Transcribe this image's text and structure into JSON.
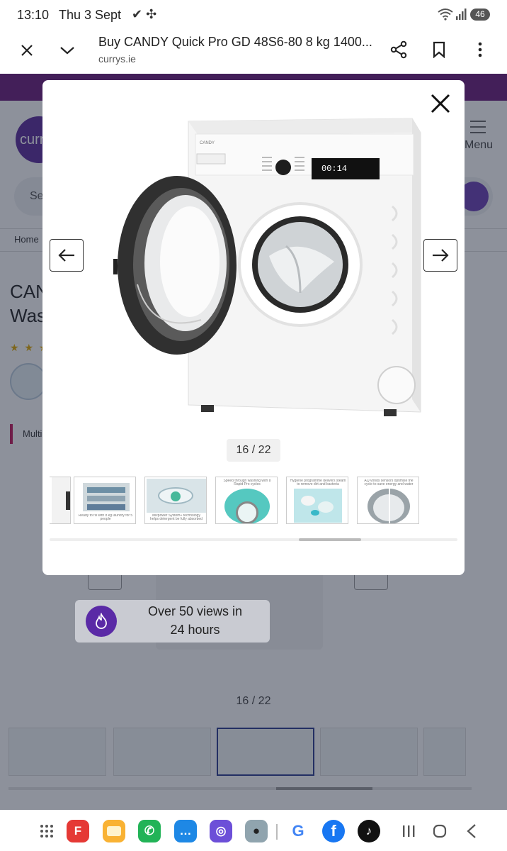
{
  "status_bar": {
    "time": "13:10",
    "date": "Thu 3 Sept",
    "notification_icons": "✔ ✣",
    "battery": "46"
  },
  "browser": {
    "title": "Buy CANDY Quick Pro GD 48S6-80 8 kg 1400...",
    "domain": "currys.ie"
  },
  "page": {
    "logo_text": "curr",
    "menu_label": "Menu",
    "search_placeholder": "Se",
    "breadcrumb_home": "Home",
    "product_title_line1": "CAN",
    "product_title_line2": "Was",
    "stars": "★ ★ ★",
    "feature_label": "Multi",
    "counter": "16 / 22"
  },
  "views_badge": {
    "line1": "Over 50 views in",
    "line2": "24 hours"
  },
  "gallery": {
    "brand_on_machine": "CANDY",
    "display_readout": "00:14",
    "counter": "16 / 22",
    "thumbnails": [
      {
        "caption": ""
      },
      {
        "caption": "Ready to fill with 8 kg laundry for 5 people"
      },
      {
        "caption": "Mixpower System+ technology helps detergent be fully absorbed"
      },
      {
        "caption": "Speed through washing with 8 Rapid Pro cycles"
      },
      {
        "caption": "Hygiene programme delivers steam to remove dirt and bacteria"
      },
      {
        "caption": "AQ vonds sensors optimise the cycle to save energy and water"
      }
    ]
  },
  "nav_apps": [
    {
      "name": "apps-grid"
    },
    {
      "name": "flipboard",
      "color": "#e53935",
      "glyph": "F"
    },
    {
      "name": "notes",
      "color": "#f9b233",
      "glyph": ""
    },
    {
      "name": "phone",
      "color": "#22b357",
      "glyph": "✆"
    },
    {
      "name": "messages",
      "color": "#1e88e5",
      "glyph": "…"
    },
    {
      "name": "browser",
      "color": "#6c4fd8",
      "glyph": "◎"
    },
    {
      "name": "camera",
      "color": "#90a4ae",
      "glyph": "●"
    },
    {
      "name": "google",
      "color": "#ffffff",
      "glyph": "G"
    },
    {
      "name": "facebook",
      "color": "#1877f2",
      "glyph": "f"
    },
    {
      "name": "tiktok",
      "color": "#111111",
      "glyph": "♪"
    }
  ],
  "colors": {
    "brand_purple": "#6b3fb5",
    "promo_bar": "#6b1a7a",
    "overlay": "rgba(28,36,56,0.5)"
  }
}
